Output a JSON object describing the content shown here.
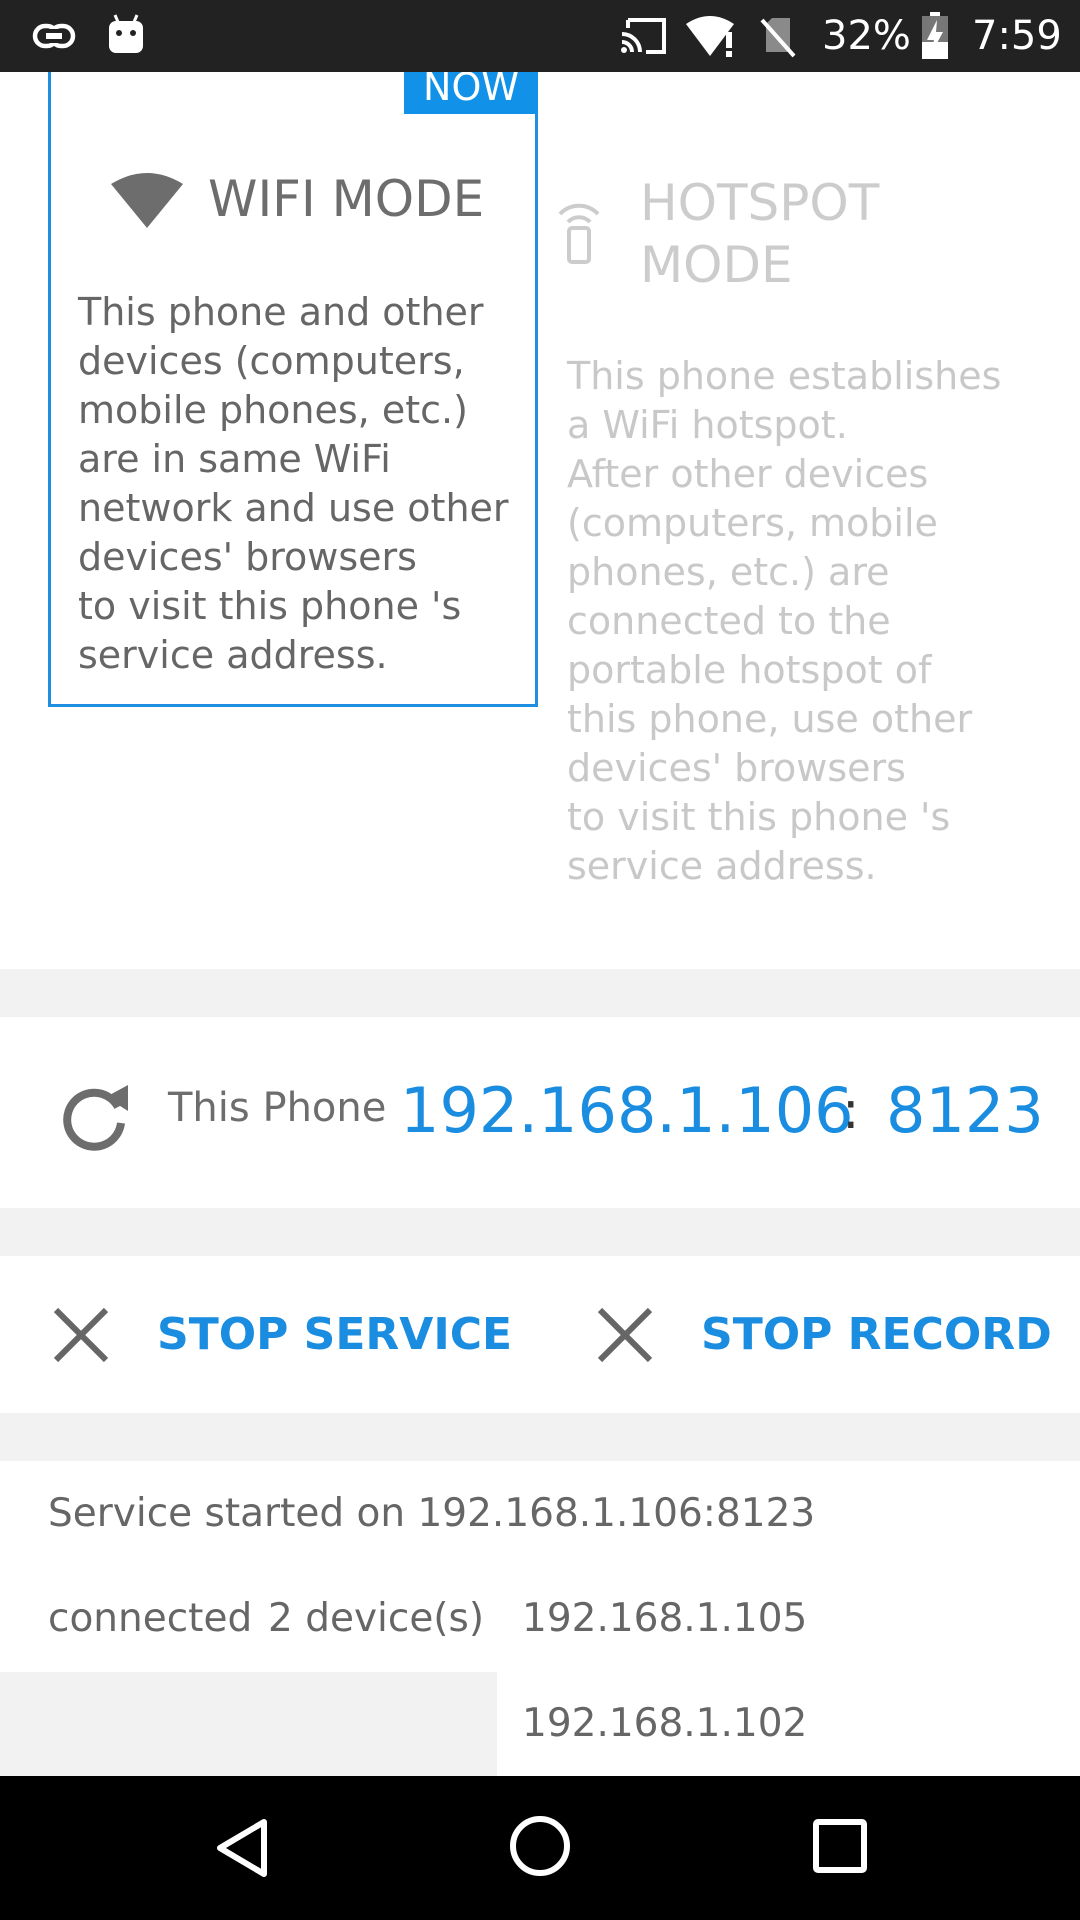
{
  "status_bar": {
    "battery_percent": "32%",
    "time": "7:59",
    "icons": [
      "link-icon",
      "android-icon",
      "cast-icon",
      "wifi-alert-icon",
      "no-sim-icon",
      "battery-charging-icon"
    ]
  },
  "wifi_mode": {
    "badge": "NOW",
    "title": "WIFI MODE",
    "description": "This phone and other\ndevices (computers,\nmobile phones, etc.)\nare in same WiFi\nnetwork and use other\ndevices' browsers\nto visit this phone 's\nservice address.",
    "icon": "wifi-icon",
    "selected": true
  },
  "hotspot_mode": {
    "title": "HOTSPOT MODE",
    "description": "This phone establishes\na WiFi hotspot.\nAfter other devices\n(computers, mobile\nphones, etc.) are\nconnected to the\nportable hotspot of\nthis phone, use other\ndevices' browsers\nto visit this phone 's\nservice address.",
    "icon": "hotspot-icon",
    "selected": false
  },
  "address": {
    "label": "This Phone",
    "ip": "192.168.1.106",
    "separator": ":",
    "port": "8123",
    "icon": "refresh-icon"
  },
  "actions": {
    "stop_service": "STOP SERVICE",
    "stop_record": "STOP RECORD",
    "icon": "close-icon"
  },
  "log": {
    "service_started": "Service started on 192.168.1.106:8123",
    "connected_label": "connected",
    "device_count": "2 device(s)",
    "devices": [
      "192.168.1.105",
      "192.168.1.102"
    ]
  },
  "colors": {
    "accent": "#1a8de0",
    "status_bar": "#222222",
    "divider": "#f2f2f2",
    "inactive_text": "#c8c8c8"
  }
}
